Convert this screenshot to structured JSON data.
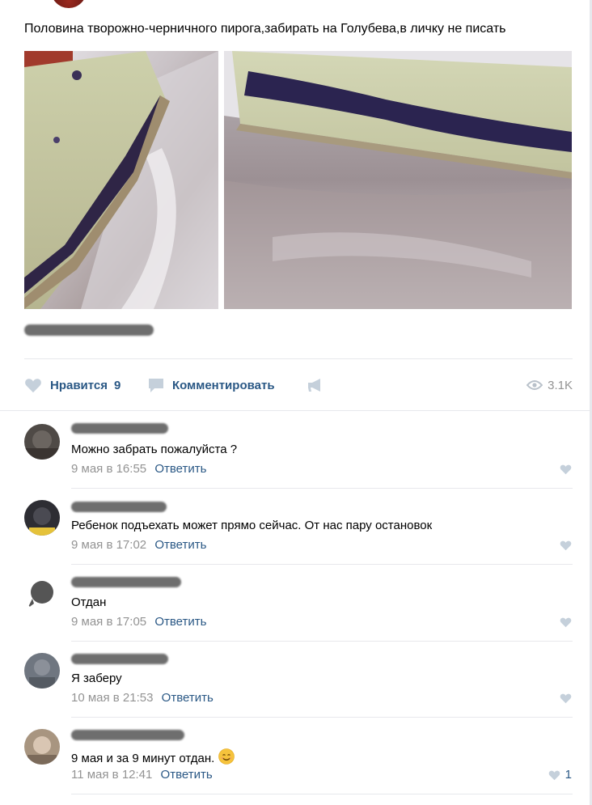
{
  "post": {
    "text": "Половина творожно-черничного пирога,забирать на Голубева,в личку не писать"
  },
  "actions": {
    "like_label": "Нравится",
    "like_count": "9",
    "comment_label": "Комментировать",
    "views_count": "3.1K"
  },
  "comments": [
    {
      "text": "Можно забрать пожалуйста ?",
      "date": "9 мая в 16:55",
      "reply": "Ответить",
      "likes": ""
    },
    {
      "text": "Ребенок подъехать может прямо сейчас. От нас пару остановок",
      "date": "9 мая в 17:02",
      "reply": "Ответить",
      "likes": ""
    },
    {
      "text": "Отдан",
      "date": "9 мая в 17:05",
      "reply": "Ответить",
      "likes": ""
    },
    {
      "text": "Я заберу",
      "date": "10 мая в 21:53",
      "reply": "Ответить",
      "likes": ""
    },
    {
      "text": "9 мая и за 9 минут отдан.",
      "date": "11 мая в 12:41",
      "reply": "Ответить",
      "likes": "1"
    }
  ],
  "colors": {
    "link": "#2a5885",
    "meta": "#939393",
    "icon": "#c5d0db",
    "divider": "#e7e8ec"
  }
}
